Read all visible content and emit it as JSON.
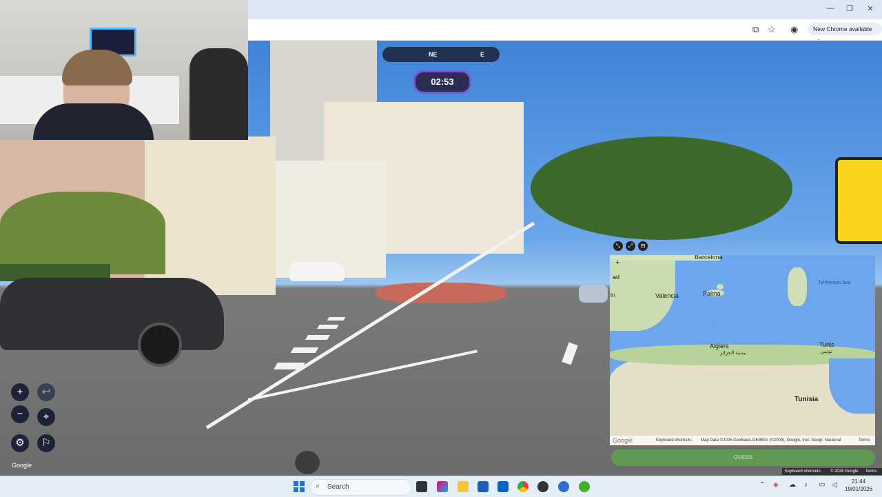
{
  "browser": {
    "new_chrome_label": "New Chrome available",
    "minimize": "—",
    "maximize": "❐",
    "close": "✕"
  },
  "game": {
    "compass": {
      "left_mark": "NE",
      "right_mark": "E"
    },
    "timer": "02:53",
    "google_watermark": "Google",
    "zoom_in": "+",
    "zoom_out": "−",
    "undo": "↩",
    "checkpoint": "⌖",
    "settings": "⚙",
    "flag": "⚐"
  },
  "map": {
    "expand_label": "⤡",
    "zoom_in": "+",
    "labels": {
      "barcelona": "Barcelona",
      "valencia": "Valencia",
      "palma": "Palma",
      "algiers": "Algiers",
      "algiers_ar": "مدينة الجزائر",
      "tunis": "Tunis",
      "tunis_ar": "تونس",
      "tunisia": "Tunisia",
      "tyrrhenian": "Tyrrhenian Sea",
      "madrid_frag": "ad",
      "in_frag": "in"
    },
    "footer": {
      "logo": "Google",
      "shortcuts": "Keyboard shortcuts",
      "map_data": "Map Data ©2025 GeoBasis-DE/BKG (©2009), Google, Inst. Geogr. Nacional",
      "terms": "Terms"
    },
    "guess_label": "GUESS",
    "outer_footer": {
      "shortcuts": "Keyboard shortcuts",
      "copyright": "© 2026 Google",
      "terms": "Terms"
    }
  },
  "taskbar": {
    "search_placeholder": "Search",
    "time": "21:44",
    "date": "19/01/2026"
  },
  "colors": {
    "accent_purple": "#7a56d8",
    "guess_green": "#5ba84a",
    "map_sea": "#6ea6ee"
  }
}
